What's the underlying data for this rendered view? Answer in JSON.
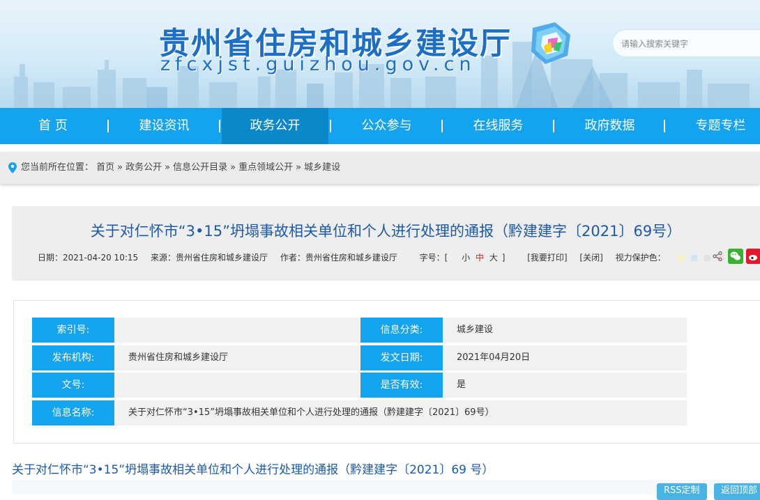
{
  "header": {
    "site_title": "贵州省住房和城乡建设厅",
    "site_domain": "zfcxjst.guizhou.gov.cn",
    "search_placeholder": "请输入搜索关键字"
  },
  "nav": {
    "items": [
      "首 页",
      "建设资讯",
      "政务公开",
      "公众参与",
      "在线服务",
      "政府数据",
      "专题专栏"
    ],
    "active": "政务公开"
  },
  "breadcrumb": {
    "prefix": "您当前所在位置：",
    "items": [
      "首页",
      "政务公开",
      "信息公开目录",
      "重点领域公开",
      "城乡建设"
    ],
    "separator": "»"
  },
  "article": {
    "title": "关于对仁怀市“3•15”坍塌事故相关单位和个人进行处理的通报（黔建建字〔2021〕69号）",
    "date": "日期：2021-04-20 10:15",
    "source": "来源：贵州省住房和城乡建设厅",
    "author": "作者：贵州省住房和城乡建设厅",
    "font_size_label": "字号：[",
    "font_small": "小",
    "font_medium": "中",
    "font_large": "大",
    "font_size_close": "]",
    "print_label": "[我要打印]",
    "close_label": "[关闭]",
    "eye_protect_label": "视力保护色：",
    "eye_colors": [
      "#f6f3c6",
      "#cfe6f4",
      "#e2e2e2",
      "#f6d8e4",
      "#e3d3f4",
      "#ffffff"
    ],
    "accent_red": "#d9251a"
  },
  "info": {
    "index_label": "索引号:",
    "index_value": "",
    "category_label": "信息分类:",
    "category_value": "城乡建设",
    "publisher_label": "发布机构:",
    "publisher_value": "贵州省住房和城乡建设厅",
    "date_label": "发文日期:",
    "date_value": "2021年04月20日",
    "doc_no_label": "文号:",
    "doc_no_value": "",
    "valid_label": "是否有效:",
    "valid_value": "是",
    "name_label": "信息名称:",
    "name_value": "关于对仁怀市“3•15”坍塌事故相关单位和个人进行处理的通报（黔建建字〔2021〕69号）"
  },
  "body": {
    "title": "关于对仁怀市“3•15”坍塌事故相关单位和个人进行处理的通报（黔建建字〔2021〕69 号）",
    "rss_label": "RSS定制",
    "top_label": "返回顶部"
  },
  "colors": {
    "nav_blue": "#14a3ee",
    "nav_active": "#0a88c9",
    "title_blue": "#1c5aa8"
  }
}
